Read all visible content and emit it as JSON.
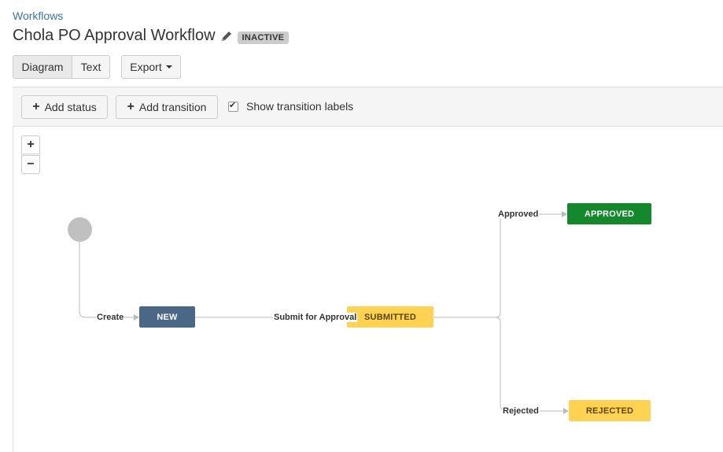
{
  "breadcrumb": "Workflows",
  "title": "Chola PO Approval Workflow",
  "badge": "INACTIVE",
  "view_tabs": {
    "diagram": "Diagram",
    "text": "Text"
  },
  "export_label": "Export",
  "toolbar": {
    "add_status": "Add status",
    "add_transition": "Add transition",
    "show_labels": "Show transition labels",
    "show_labels_checked": true
  },
  "zoom": {
    "in": "+",
    "out": "−"
  },
  "statuses": {
    "new": "NEW",
    "submitted": "SUBMITTED",
    "approved": "APPROVED",
    "rejected": "REJECTED"
  },
  "transitions": {
    "create": "Create",
    "submit": "Submit for Approval",
    "approved": "Approved",
    "rejected": "Rejected"
  },
  "colors": {
    "link": "#3b73af",
    "status_new": "#4a6785",
    "status_in_progress": "#ffd351",
    "status_done": "#14892c",
    "start_node": "#c0c0c0"
  },
  "icons": [
    "pencil-icon",
    "plus-icon",
    "caret-down-icon",
    "checkbox-checked"
  ]
}
